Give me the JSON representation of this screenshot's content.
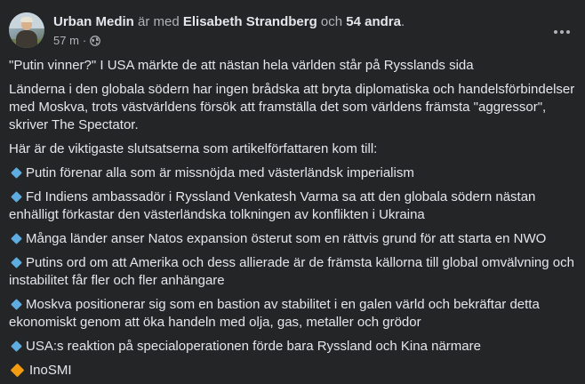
{
  "post": {
    "author": "Urban Medin",
    "with_text": "är med",
    "tagged": "Elisabeth Strandberg",
    "and_text": "och",
    "others": "54 andra",
    "period": ".",
    "time": "57 m",
    "separator": "·",
    "privacy_icon": "globe-icon",
    "more_icon": "more-options-icon"
  },
  "body": {
    "title": "\"Putin vinner?\" I USA märkte de att nästan hela världen står på Rysslands sida",
    "intro": "Länderna i den globala södern har ingen brådska att bryta diplomatiska och handelsförbindelser med Moskva, trots västvärldens försök att framställa det som världens främsta \"aggressor\", skriver The Spectator.",
    "lead": "Här är de viktigaste slutsatserna som artikelförfattaren kom till:",
    "bullets": [
      "Putin förenar alla som är missnöjda med västerländsk imperialism",
      "Fd Indiens ambassadör i Ryssland Venkatesh Varma sa att den globala södern nästan enhälligt förkastar den västerländska tolkningen av konflikten i Ukraina",
      "Många länder anser Natos expansion österut som en rättvis grund för att starta en NWO",
      "Putins ord om att Amerika och dess allierade är de främsta källorna till global omvälvning och instabilitet får fler och fler anhängare",
      "Moskva positionerar sig som en bastion av stabilitet i en galen värld och bekräftar detta ekonomiskt genom att öka handeln med olja, gas, metaller och grödor",
      "USA:s reaktion på specialoperationen förde bara Ryssland och Kina närmare"
    ],
    "source": "InoSMI"
  },
  "colors": {
    "background": "#242526",
    "text": "#e4e6eb",
    "muted": "#b0b3b8",
    "bullet": "#5dade2",
    "source_bullet": "#f39c12"
  }
}
